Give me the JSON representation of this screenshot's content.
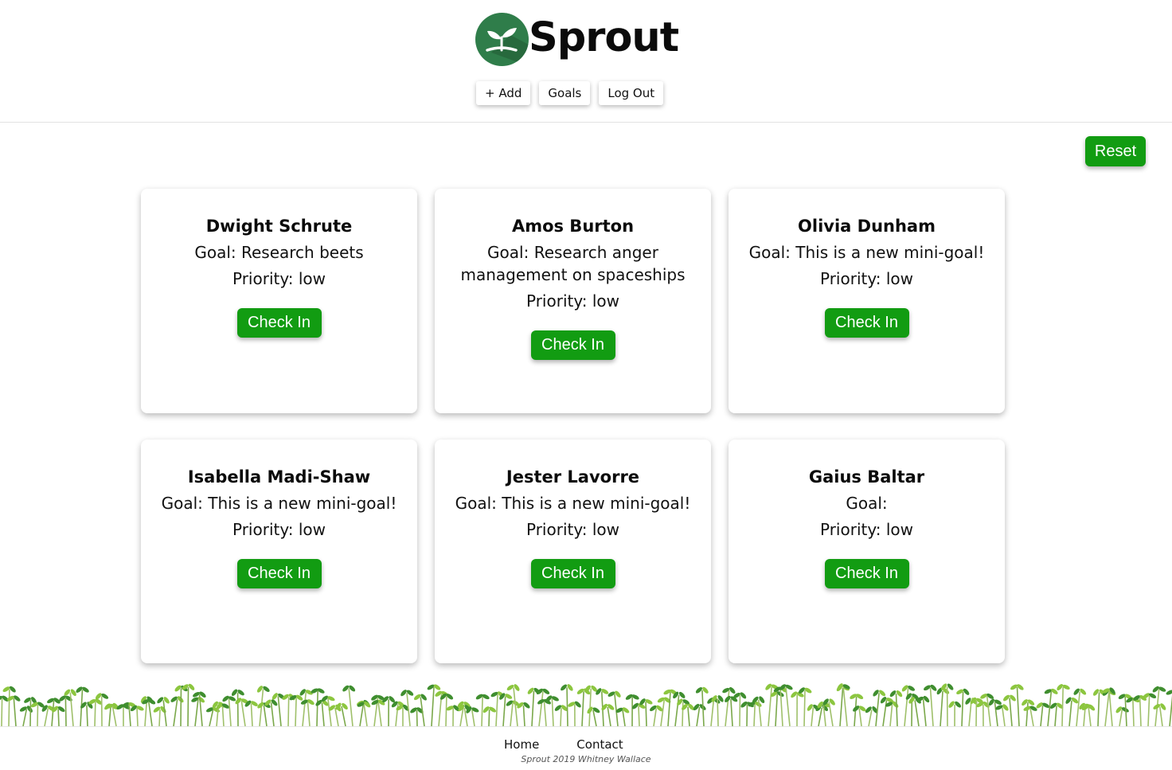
{
  "app": {
    "brand": "Sprout",
    "logo_icon": "sprout-icon"
  },
  "nav": {
    "add_label": "+ Add",
    "goals_label": "Goals",
    "logout_label": "Log Out"
  },
  "reset_label": "Reset",
  "cards": [
    {
      "name": "Dwight Schrute",
      "goal": "Goal: Research beets",
      "priority": "Priority: low",
      "button": "Check In"
    },
    {
      "name": "Amos Burton",
      "goal": "Goal: Research anger management on spaceships",
      "priority": "Priority: low",
      "button": "Check In"
    },
    {
      "name": "Olivia Dunham",
      "goal": "Goal: This is a new mini-goal!",
      "priority": "Priority: low",
      "button": "Check In"
    },
    {
      "name": "Isabella Madi-Shaw",
      "goal": "Goal: This is a new mini-goal!",
      "priority": "Priority: low",
      "button": "Check In"
    },
    {
      "name": "Jester Lavorre",
      "goal": "Goal: This is a new mini-goal!",
      "priority": "Priority: low",
      "button": "Check In"
    },
    {
      "name": "Gaius Baltar",
      "goal": "Goal:",
      "priority": "Priority: low",
      "button": "Check In"
    }
  ],
  "footer": {
    "home_label": "Home",
    "contact_label": "Contact",
    "credit": "Sprout 2019 Whitney Wallace"
  },
  "colors": {
    "accent": "#129c12",
    "logo_bg": "#2f7d4a",
    "sprout_light": "#8cc63f",
    "sprout_dark": "#3f8e2f"
  }
}
